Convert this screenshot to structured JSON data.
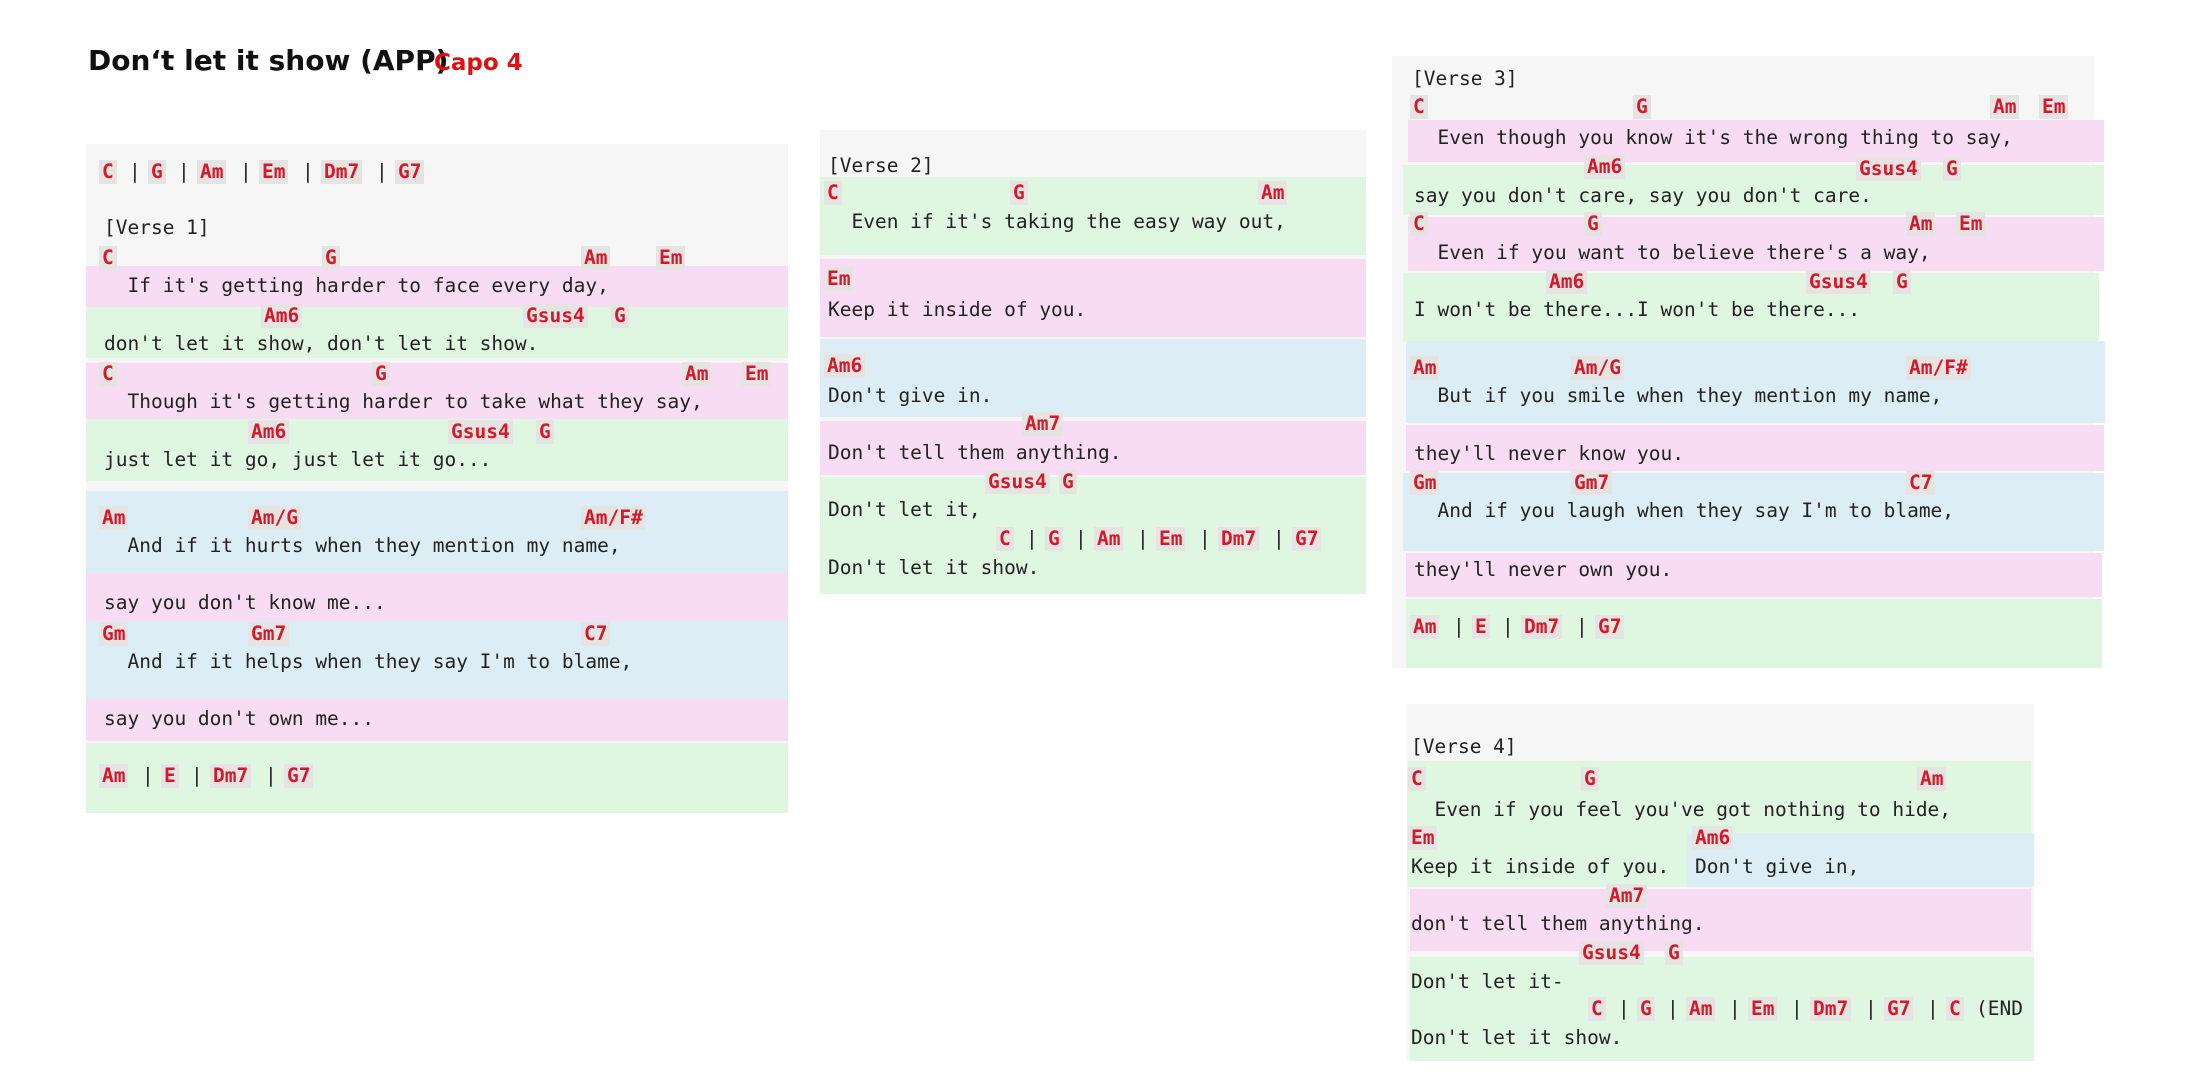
{
  "header": {
    "title": "Don‘t let it show (APP)",
    "capo": "Capo 4"
  },
  "intro": {
    "chords": [
      "C",
      "G",
      "Am",
      "Em",
      "Dm7",
      "G7"
    ],
    "separator": "|"
  },
  "verse1": {
    "label": "[Verse 1]",
    "lines": [
      {
        "chords": [
          "C",
          "G",
          "Am",
          "Em"
        ],
        "text": "  If it's getting harder to face every day,"
      },
      {
        "chords": [
          "Am6",
          "Gsus4",
          "G"
        ],
        "text": "don't let it show, don't let it show."
      },
      {
        "chords": [
          "C",
          "G",
          "Am",
          "Em"
        ],
        "text": "  Though it's getting harder to take what they say,"
      },
      {
        "chords": [
          "Am6",
          "Gsus4",
          "G"
        ],
        "text": "just let it go, just let it go..."
      },
      {
        "chords": [
          "Am",
          "Am/G",
          "Am/F#"
        ],
        "text": "  And if it hurts when they mention my name,"
      },
      {
        "chords": [],
        "text": "say you don't know me..."
      },
      {
        "chords": [
          "Gm",
          "Gm7",
          "C7"
        ],
        "text": "  And if it helps when they say I'm to blame,"
      },
      {
        "chords": [],
        "text": "say you don't own me..."
      }
    ],
    "outro": [
      "Am",
      "E",
      "Dm7",
      "G7"
    ]
  },
  "verse2": {
    "label": "[Verse 2]",
    "lines": [
      {
        "chords": [
          "C",
          "G",
          "Am"
        ],
        "text": "  Even if it's taking the easy way out,"
      },
      {
        "chords": [
          "Em"
        ],
        "text": "Keep it inside of you."
      },
      {
        "chords": [
          "Am6"
        ],
        "text": "Don't give in."
      },
      {
        "chords": [
          "Am7"
        ],
        "text": "Don't tell them anything."
      },
      {
        "chords": [
          "Gsus4",
          "G"
        ],
        "text": "Don't let it,"
      },
      {
        "chords": [
          "C",
          "G",
          "Am",
          "Em",
          "Dm7",
          "G7"
        ],
        "text": "Don't let it show."
      }
    ]
  },
  "verse3": {
    "label": "[Verse 3]",
    "lines": [
      {
        "chords": [
          "C",
          "G",
          "Am",
          "Em"
        ],
        "text": "  Even though you know it's the wrong thing to say,"
      },
      {
        "chords": [
          "Am6",
          "Gsus4",
          "G"
        ],
        "text": "say you don't care, say you don't care."
      },
      {
        "chords": [
          "C",
          "G",
          "Am",
          "Em"
        ],
        "text": "  Even if you want to believe there's a way,"
      },
      {
        "chords": [
          "Am6",
          "Gsus4",
          "G"
        ],
        "text": "I won't be there...I won't be there..."
      },
      {
        "chords": [
          "Am",
          "Am/G",
          "Am/F#"
        ],
        "text": "  But if you smile when they mention my name,"
      },
      {
        "chords": [],
        "text": "they'll never know you."
      },
      {
        "chords": [
          "Gm",
          "Gm7",
          "C7"
        ],
        "text": "  And if you laugh when they say I'm to blame,"
      },
      {
        "chords": [],
        "text": "they'll never own you."
      }
    ],
    "outro": [
      "Am",
      "E",
      "Dm7",
      "G7"
    ]
  },
  "verse4": {
    "label": "[Verse 4]",
    "lines": [
      {
        "chords": [
          "C",
          "G",
          "Am"
        ],
        "text": "  Even if you feel you've got nothing to hide,"
      },
      {
        "chords": [
          "Em",
          "Am6"
        ],
        "text": "Keep it inside of you.",
        "text2": "Don't give in,"
      },
      {
        "chords": [
          "Am7"
        ],
        "text": "don't tell them anything."
      },
      {
        "chords": [
          "Gsus4",
          "G"
        ],
        "text": "Don't let it-"
      },
      {
        "chords": [
          "C",
          "G",
          "Am",
          "Em",
          "Dm7",
          "G7",
          "C"
        ],
        "text": "Don't let it show.",
        "end_note": "(END"
      }
    ]
  }
}
